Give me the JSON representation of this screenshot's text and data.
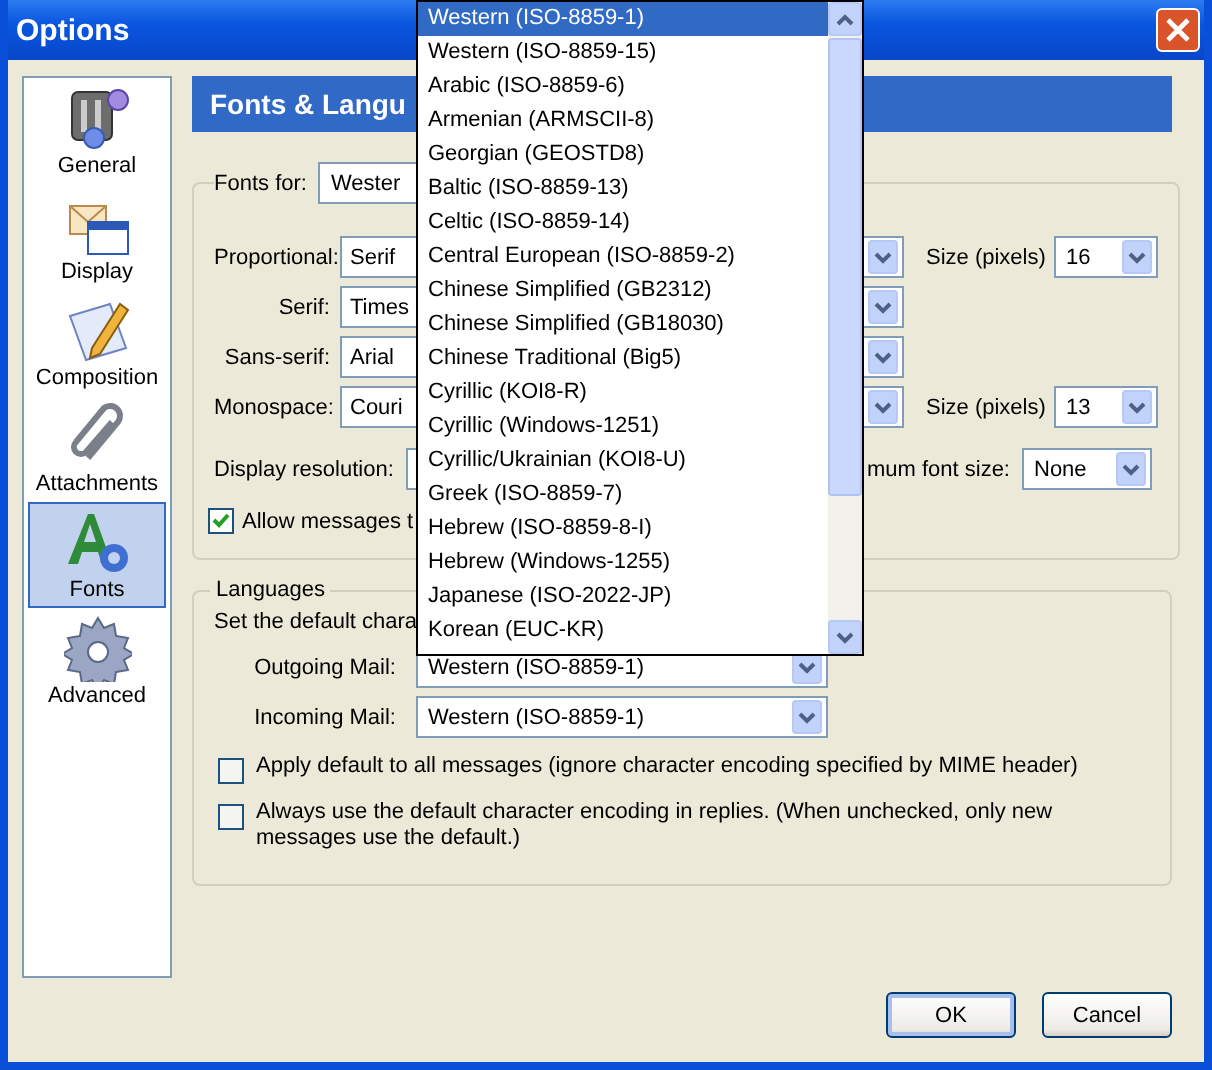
{
  "window": {
    "title": "Options"
  },
  "sidebar": {
    "items": [
      {
        "label": "General",
        "kind": "general",
        "selected": false
      },
      {
        "label": "Display",
        "kind": "display",
        "selected": false
      },
      {
        "label": "Composition",
        "kind": "composition",
        "selected": false
      },
      {
        "label": "Attachments",
        "kind": "attachments",
        "selected": false
      },
      {
        "label": "Fonts",
        "kind": "fonts",
        "selected": true
      },
      {
        "label": "Advanced",
        "kind": "advanced",
        "selected": false
      }
    ]
  },
  "header": "Fonts & Langu",
  "fonts": {
    "fonts_for": {
      "label": "Fonts for:",
      "value": "Wester"
    },
    "rows": [
      {
        "label": "Proportional:",
        "value": "Serif",
        "size_label": "Size (pixels)",
        "size_value": "16"
      },
      {
        "label": "Serif:",
        "value": "Times"
      },
      {
        "label": "Sans-serif:",
        "value": "Arial"
      },
      {
        "label": "Monospace:",
        "value": "Couri",
        "size_label": "Size (pixels)",
        "size_value": "13"
      }
    ],
    "display_resolution": {
      "label": "Display resolution:"
    },
    "min_font_size": {
      "label": "mum font size:",
      "value": "None"
    },
    "allow_messages": {
      "label": "Allow messages t",
      "checked": true
    }
  },
  "languages": {
    "title": "Languages",
    "intro": "Set the default chara",
    "outgoing": {
      "label": "Outgoing Mail:",
      "value": "Western (ISO-8859-1)"
    },
    "incoming": {
      "label": "Incoming Mail:",
      "value": "Western (ISO-8859-1)"
    },
    "options": [
      {
        "label": "Apply default to all messages (ignore character encoding specified by MIME header)",
        "checked": false
      },
      {
        "label": "Always use the default character encoding in replies. (When unchecked, only new messages use the default.)",
        "checked": false
      }
    ]
  },
  "dropdown": {
    "items": [
      {
        "label": "Western (ISO-8859-1)",
        "selected": true
      },
      {
        "label": "Western (ISO-8859-15)",
        "selected": false
      },
      {
        "label": "Arabic (ISO-8859-6)",
        "selected": false
      },
      {
        "label": "Armenian (ARMSCII-8)",
        "selected": false
      },
      {
        "label": "Georgian (GEOSTD8)",
        "selected": false
      },
      {
        "label": "Baltic (ISO-8859-13)",
        "selected": false
      },
      {
        "label": "Celtic (ISO-8859-14)",
        "selected": false
      },
      {
        "label": "Central European (ISO-8859-2)",
        "selected": false
      },
      {
        "label": "Chinese Simplified (GB2312)",
        "selected": false
      },
      {
        "label": "Chinese Simplified (GB18030)",
        "selected": false
      },
      {
        "label": "Chinese Traditional (Big5)",
        "selected": false
      },
      {
        "label": "Cyrillic (KOI8-R)",
        "selected": false
      },
      {
        "label": "Cyrillic (Windows-1251)",
        "selected": false
      },
      {
        "label": "Cyrillic/Ukrainian (KOI8-U)",
        "selected": false
      },
      {
        "label": "Greek (ISO-8859-7)",
        "selected": false
      },
      {
        "label": "Hebrew (ISO-8859-8-I)",
        "selected": false
      },
      {
        "label": "Hebrew (Windows-1255)",
        "selected": false
      },
      {
        "label": "Japanese (ISO-2022-JP)",
        "selected": false
      },
      {
        "label": "Korean (EUC-KR)",
        "selected": false
      }
    ]
  },
  "buttons": [
    {
      "label": "OK",
      "default": true
    },
    {
      "label": "Cancel",
      "default": false
    }
  ]
}
